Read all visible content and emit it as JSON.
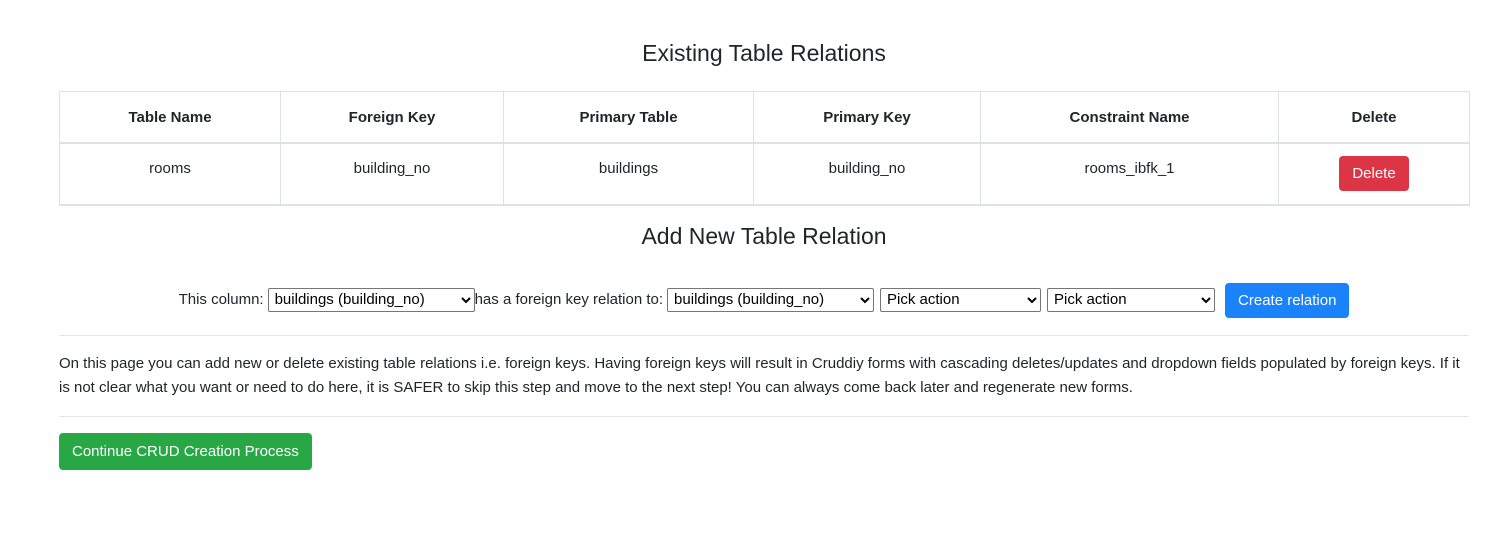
{
  "existing": {
    "title": "Existing Table Relations",
    "columns": [
      "Table Name",
      "Foreign Key",
      "Primary Table",
      "Primary Key",
      "Constraint Name",
      "Delete"
    ],
    "rows": [
      {
        "table_name": "rooms",
        "foreign_key": "building_no",
        "primary_table": "buildings",
        "primary_key": "building_no",
        "constraint_name": "rooms_ibfk_1",
        "delete_label": "Delete"
      }
    ]
  },
  "add": {
    "title": "Add New Table Relation",
    "column_label": "This column:",
    "column_select_value": "buildings (building_no)",
    "relation_label": "has a foreign key relation to:",
    "reference_select_value": "buildings (building_no)",
    "on_delete_select_value": "Pick action",
    "on_update_select_value": "Pick action",
    "create_label": "Create relation"
  },
  "info_text": "On this page you can add new or delete existing table relations i.e. foreign keys. Having foreign keys will result in Cruddiy forms with cascading deletes/updates and dropdown fields populated by foreign keys. If it is not clear what you want or need to do here, it is SAFER to skip this step and move to the next step! You can always come back later and regenerate new forms.",
  "continue_label": "Continue CRUD Creation Process",
  "colors": {
    "danger": "#dc3545",
    "primary": "#1a82fb",
    "success": "#28a745"
  }
}
